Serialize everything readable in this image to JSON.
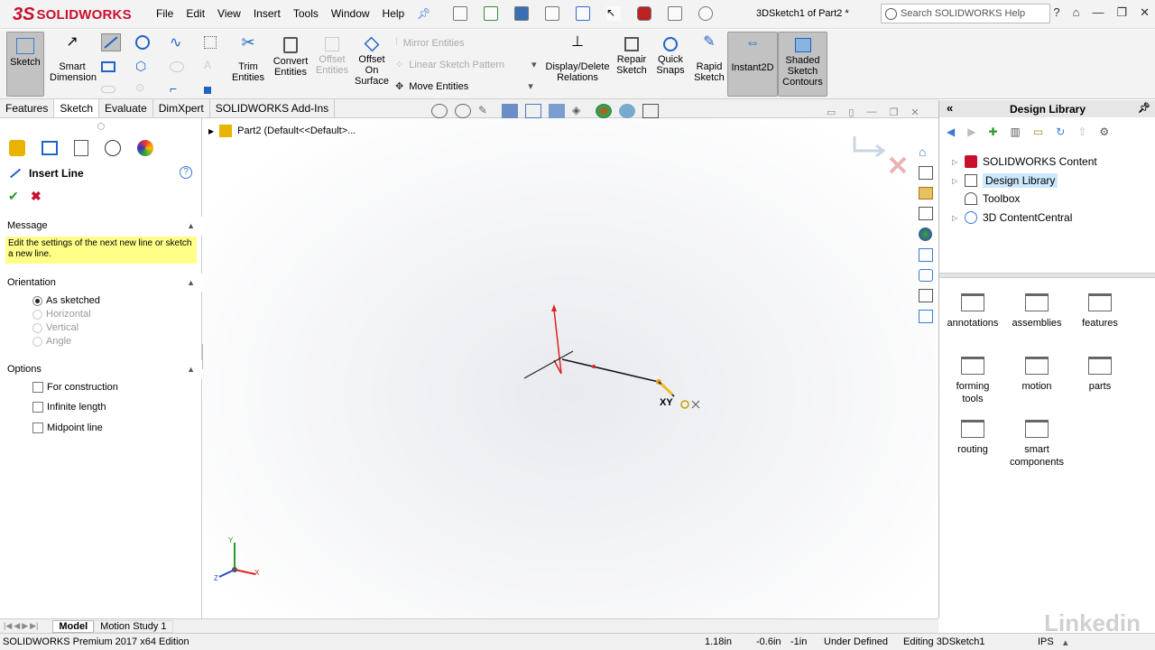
{
  "app": {
    "name": "SOLIDWORKS",
    "logo_prefix": "3S",
    "document_title": "3DSketch1 of Part2 *"
  },
  "menu": [
    "File",
    "Edit",
    "View",
    "Insert",
    "Tools",
    "Window",
    "Help"
  ],
  "search": {
    "placeholder": "Search SOLIDWORKS Help"
  },
  "ribbon": {
    "sketch": "Sketch",
    "smart_dimension": "Smart Dimension",
    "trim_entities": "Trim Entities",
    "convert_entities": "Convert Entities",
    "offset_entities": "Offset Entities",
    "offset_on_surface": "Offset On Surface",
    "mirror_entities": "Mirror Entities",
    "linear_sketch_pattern": "Linear Sketch Pattern",
    "move_entities": "Move Entities",
    "display_delete_relations": "Display/Delete Relations",
    "repair_sketch": "Repair Sketch",
    "quick_snaps": "Quick Snaps",
    "rapid_sketch": "Rapid Sketch",
    "instant2d": "Instant2D",
    "shaded_sketch_contours": "Shaded Sketch Contours"
  },
  "tabs": [
    "Features",
    "Sketch",
    "Evaluate",
    "DimXpert",
    "SOLIDWORKS Add-Ins"
  ],
  "tree_root": "Part2  (Default<<Default>...",
  "property_manager": {
    "title": "Insert Line",
    "message_header": "Message",
    "message": "Edit the settings of the next new line or sketch a new line.",
    "orientation_header": "Orientation",
    "orientation": [
      "As sketched",
      "Horizontal",
      "Vertical",
      "Angle"
    ],
    "options_header": "Options",
    "options": [
      "For construction",
      "Infinite length",
      "Midpoint line"
    ]
  },
  "cursor_label": "XY",
  "design_library": {
    "title": "Design Library",
    "tree": [
      "SOLIDWORKS Content",
      "Design Library",
      "Toolbox",
      "3D ContentCentral"
    ],
    "folders": [
      "annotations",
      "assemblies",
      "features",
      "forming tools",
      "motion",
      "parts",
      "routing",
      "smart components"
    ]
  },
  "bottom_tabs": [
    "Model",
    "Motion Study 1"
  ],
  "status": {
    "edition": "SOLIDWORKS Premium 2017 x64 Edition",
    "x": "1.18in",
    "y": "-0.6in",
    "z": "-1in",
    "state": "Under Defined",
    "editing": "Editing 3DSketch1",
    "units": "IPS"
  },
  "watermark": "Linkedin",
  "colors": {
    "brand": "#c8102e",
    "message_bg": "#ffff88",
    "selection": "#cce8ff"
  }
}
